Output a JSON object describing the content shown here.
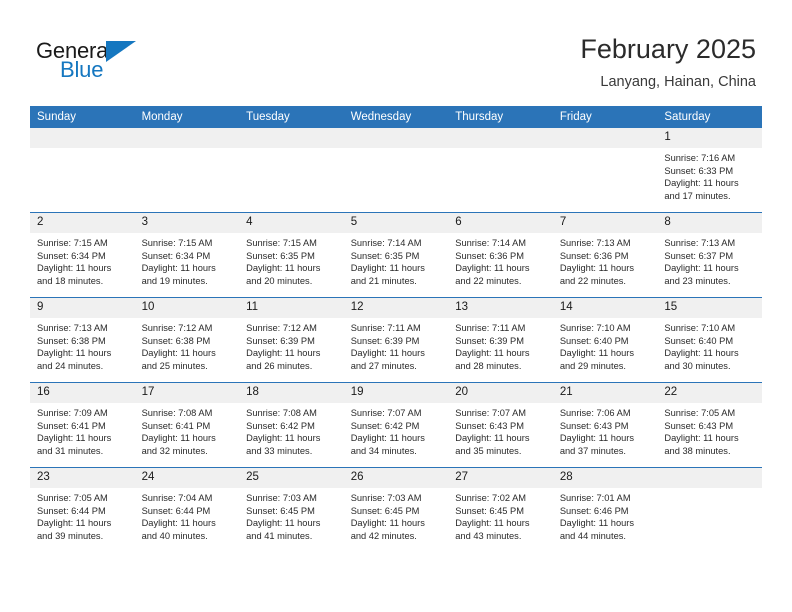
{
  "brand": {
    "word_one": "General",
    "word_two": "Blue",
    "flag_icon": "triangle-flag-icon",
    "accent_color": "#1577c0"
  },
  "header": {
    "title": "February 2025",
    "location": "Lanyang, Hainan, China"
  },
  "calendar": {
    "header_bg": "#2b74b8",
    "daynum_bg": "#f0f0f0",
    "weekday_headers": [
      "Sunday",
      "Monday",
      "Tuesday",
      "Wednesday",
      "Thursday",
      "Friday",
      "Saturday"
    ],
    "weeks": [
      [
        {
          "day": "",
          "blank": true
        },
        {
          "day": "",
          "blank": true
        },
        {
          "day": "",
          "blank": true
        },
        {
          "day": "",
          "blank": true
        },
        {
          "day": "",
          "blank": true
        },
        {
          "day": "",
          "blank": true
        },
        {
          "day": "1",
          "sunrise": "Sunrise: 7:16 AM",
          "sunset": "Sunset: 6:33 PM",
          "daylight": "Daylight: 11 hours and 17 minutes."
        }
      ],
      [
        {
          "day": "2",
          "sunrise": "Sunrise: 7:15 AM",
          "sunset": "Sunset: 6:34 PM",
          "daylight": "Daylight: 11 hours and 18 minutes."
        },
        {
          "day": "3",
          "sunrise": "Sunrise: 7:15 AM",
          "sunset": "Sunset: 6:34 PM",
          "daylight": "Daylight: 11 hours and 19 minutes."
        },
        {
          "day": "4",
          "sunrise": "Sunrise: 7:15 AM",
          "sunset": "Sunset: 6:35 PM",
          "daylight": "Daylight: 11 hours and 20 minutes."
        },
        {
          "day": "5",
          "sunrise": "Sunrise: 7:14 AM",
          "sunset": "Sunset: 6:35 PM",
          "daylight": "Daylight: 11 hours and 21 minutes."
        },
        {
          "day": "6",
          "sunrise": "Sunrise: 7:14 AM",
          "sunset": "Sunset: 6:36 PM",
          "daylight": "Daylight: 11 hours and 22 minutes."
        },
        {
          "day": "7",
          "sunrise": "Sunrise: 7:13 AM",
          "sunset": "Sunset: 6:36 PM",
          "daylight": "Daylight: 11 hours and 22 minutes."
        },
        {
          "day": "8",
          "sunrise": "Sunrise: 7:13 AM",
          "sunset": "Sunset: 6:37 PM",
          "daylight": "Daylight: 11 hours and 23 minutes."
        }
      ],
      [
        {
          "day": "9",
          "sunrise": "Sunrise: 7:13 AM",
          "sunset": "Sunset: 6:38 PM",
          "daylight": "Daylight: 11 hours and 24 minutes."
        },
        {
          "day": "10",
          "sunrise": "Sunrise: 7:12 AM",
          "sunset": "Sunset: 6:38 PM",
          "daylight": "Daylight: 11 hours and 25 minutes."
        },
        {
          "day": "11",
          "sunrise": "Sunrise: 7:12 AM",
          "sunset": "Sunset: 6:39 PM",
          "daylight": "Daylight: 11 hours and 26 minutes."
        },
        {
          "day": "12",
          "sunrise": "Sunrise: 7:11 AM",
          "sunset": "Sunset: 6:39 PM",
          "daylight": "Daylight: 11 hours and 27 minutes."
        },
        {
          "day": "13",
          "sunrise": "Sunrise: 7:11 AM",
          "sunset": "Sunset: 6:39 PM",
          "daylight": "Daylight: 11 hours and 28 minutes."
        },
        {
          "day": "14",
          "sunrise": "Sunrise: 7:10 AM",
          "sunset": "Sunset: 6:40 PM",
          "daylight": "Daylight: 11 hours and 29 minutes."
        },
        {
          "day": "15",
          "sunrise": "Sunrise: 7:10 AM",
          "sunset": "Sunset: 6:40 PM",
          "daylight": "Daylight: 11 hours and 30 minutes."
        }
      ],
      [
        {
          "day": "16",
          "sunrise": "Sunrise: 7:09 AM",
          "sunset": "Sunset: 6:41 PM",
          "daylight": "Daylight: 11 hours and 31 minutes."
        },
        {
          "day": "17",
          "sunrise": "Sunrise: 7:08 AM",
          "sunset": "Sunset: 6:41 PM",
          "daylight": "Daylight: 11 hours and 32 minutes."
        },
        {
          "day": "18",
          "sunrise": "Sunrise: 7:08 AM",
          "sunset": "Sunset: 6:42 PM",
          "daylight": "Daylight: 11 hours and 33 minutes."
        },
        {
          "day": "19",
          "sunrise": "Sunrise: 7:07 AM",
          "sunset": "Sunset: 6:42 PM",
          "daylight": "Daylight: 11 hours and 34 minutes."
        },
        {
          "day": "20",
          "sunrise": "Sunrise: 7:07 AM",
          "sunset": "Sunset: 6:43 PM",
          "daylight": "Daylight: 11 hours and 35 minutes."
        },
        {
          "day": "21",
          "sunrise": "Sunrise: 7:06 AM",
          "sunset": "Sunset: 6:43 PM",
          "daylight": "Daylight: 11 hours and 37 minutes."
        },
        {
          "day": "22",
          "sunrise": "Sunrise: 7:05 AM",
          "sunset": "Sunset: 6:43 PM",
          "daylight": "Daylight: 11 hours and 38 minutes."
        }
      ],
      [
        {
          "day": "23",
          "sunrise": "Sunrise: 7:05 AM",
          "sunset": "Sunset: 6:44 PM",
          "daylight": "Daylight: 11 hours and 39 minutes."
        },
        {
          "day": "24",
          "sunrise": "Sunrise: 7:04 AM",
          "sunset": "Sunset: 6:44 PM",
          "daylight": "Daylight: 11 hours and 40 minutes."
        },
        {
          "day": "25",
          "sunrise": "Sunrise: 7:03 AM",
          "sunset": "Sunset: 6:45 PM",
          "daylight": "Daylight: 11 hours and 41 minutes."
        },
        {
          "day": "26",
          "sunrise": "Sunrise: 7:03 AM",
          "sunset": "Sunset: 6:45 PM",
          "daylight": "Daylight: 11 hours and 42 minutes."
        },
        {
          "day": "27",
          "sunrise": "Sunrise: 7:02 AM",
          "sunset": "Sunset: 6:45 PM",
          "daylight": "Daylight: 11 hours and 43 minutes."
        },
        {
          "day": "28",
          "sunrise": "Sunrise: 7:01 AM",
          "sunset": "Sunset: 6:46 PM",
          "daylight": "Daylight: 11 hours and 44 minutes."
        },
        {
          "day": "",
          "blank": true
        }
      ]
    ]
  }
}
